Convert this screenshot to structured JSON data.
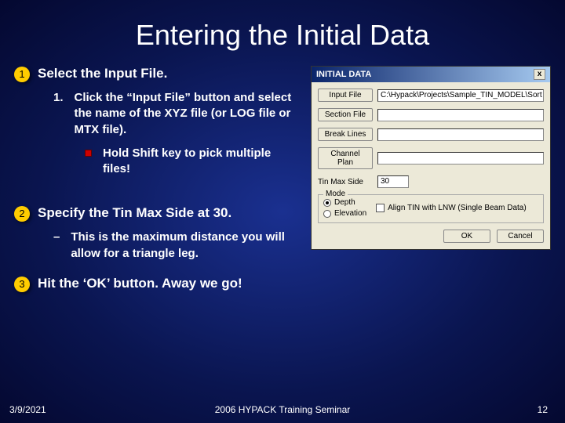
{
  "title": "Entering the Initial Data",
  "steps": {
    "s1": {
      "badge": "1",
      "heading": "Select the Input File.",
      "sub_num": "1.",
      "sub_text": "Click the “Input File” button and select the name of the XYZ file (or LOG file or MTX file).",
      "note": "Hold Shift key to pick multiple files!"
    },
    "s2": {
      "badge": "2",
      "heading": "Specify the Tin Max Side at 30.",
      "dash": "–",
      "sub_text": "This is the maximum distance you will allow for a triangle leg."
    },
    "s3": {
      "badge": "3",
      "heading": "Hit the ‘OK’ button.  Away we go!"
    }
  },
  "dialog": {
    "title": "INITIAL DATA",
    "close": "x",
    "input_file_btn": "Input File",
    "input_file_val": "C:\\Hypack\\Projects\\Sample_TIN_MODEL\\Sort",
    "section_btn": "Section File",
    "break_btn": "Break Lines",
    "channel_btn": "Channel Plan",
    "tinmax_label": "Tin Max Side",
    "tinmax_val": "30",
    "mode_label": "Mode",
    "depth_label": "Depth",
    "elev_label": "Elevation",
    "align_label": "Align TIN with LNW (Single Beam Data)",
    "ok": "OK",
    "cancel": "Cancel"
  },
  "footer": {
    "date": "3/9/2021",
    "center": "2006 HYPACK Training Seminar",
    "page": "12"
  }
}
